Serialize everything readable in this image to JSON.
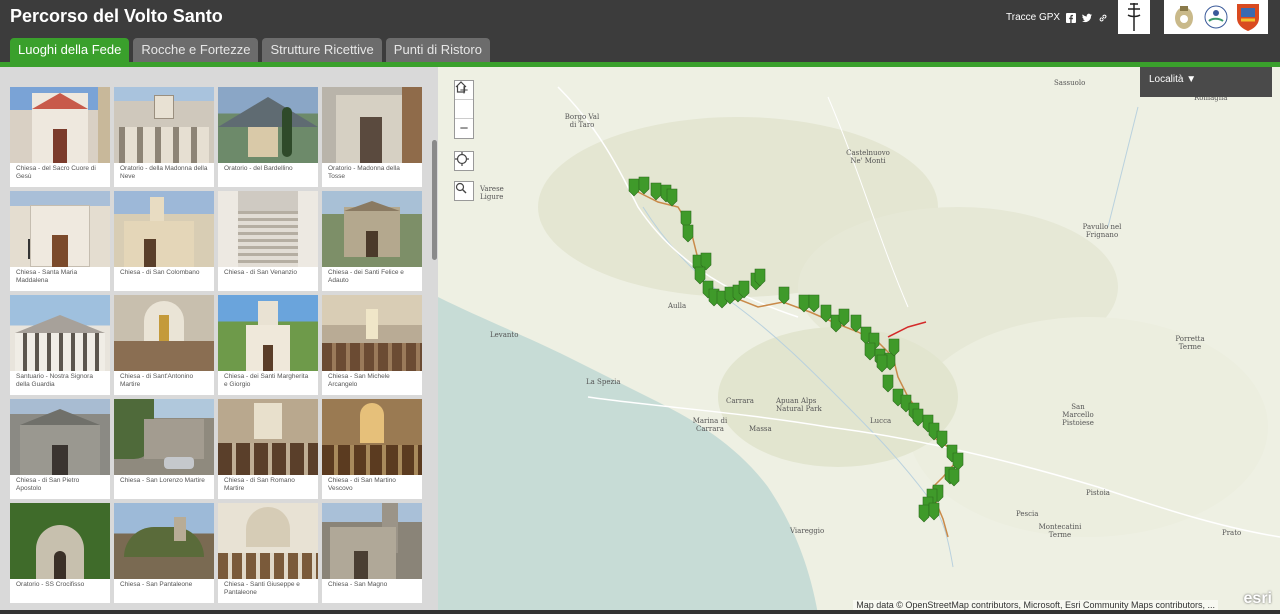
{
  "header": {
    "title": "Percorso del Volto Santo",
    "gpx_label": "Tracce GPX",
    "tabs": [
      {
        "label": "Luoghi della Fede",
        "active": true
      },
      {
        "label": "Rocche e Fortezze",
        "active": false
      },
      {
        "label": "Strutture Ricettive",
        "active": false
      },
      {
        "label": "Punti di Ristoro",
        "active": false
      }
    ],
    "icons": [
      "facebook-icon",
      "twitter-icon",
      "link-icon"
    ],
    "accent_color": "#3aa02c"
  },
  "gallery": {
    "cards": [
      {
        "caption": "Chiesa - del Sacro Cuore di Gesù"
      },
      {
        "caption": "Oratorio - della Madonna della Neve"
      },
      {
        "caption": "Oratorio - del Bardellino"
      },
      {
        "caption": "Oratorio - Madonna della Tosse"
      },
      {
        "caption": "Chiesa - Santa Maria Maddalena"
      },
      {
        "caption": "Chiesa - di San Colombano"
      },
      {
        "caption": "Chiesa - di San Venanzio"
      },
      {
        "caption": "Chiesa - dei Santi Felice e Adauto"
      },
      {
        "caption": "Santuario - Nostra Signora della Guardia"
      },
      {
        "caption": "Chiesa - di Sant'Antonino Martire"
      },
      {
        "caption": "Chiesa - dei Santi Margherita e Giorgio"
      },
      {
        "caption": "Chiesa - San Michele Arcangelo"
      },
      {
        "caption": "Chiesa - di San Pietro Apostolo"
      },
      {
        "caption": "Chiesa - San Lorenzo Martire"
      },
      {
        "caption": "Chiesa - di San Romano Martire"
      },
      {
        "caption": "Chiesa - di San Martino Vescovo"
      },
      {
        "caption": "Oratorio - SS Crocifisso"
      },
      {
        "caption": "Chiesa - San Pantaleone"
      },
      {
        "caption": "Chiesa - Santi Giuseppe e Pantaleone"
      },
      {
        "caption": "Chiesa - San Magno"
      }
    ]
  },
  "map": {
    "localita_label": "Località ▼",
    "attribution": "Map data © OpenStreetMap contributors, Microsoft, Esri Community Maps contributors, ...",
    "esri_label": "esri",
    "places": [
      "Sassuolo",
      "Borgo Val di Taro",
      "Castelnuovo Ne' Monti",
      "Varese Ligure",
      "Pavullo nel Frignano",
      "Aulla",
      "La Spezia",
      "Levanto",
      "Carrara",
      "Marina di Carrara",
      "Massa",
      "Apuan Alps Natural Park",
      "Lucca",
      "Viareggio",
      "Porretta Terme",
      "San Marcello Pistoiese",
      "Pistoia",
      "Pescia",
      "Montecatini Terme",
      "Prato",
      "Romagna"
    ]
  }
}
